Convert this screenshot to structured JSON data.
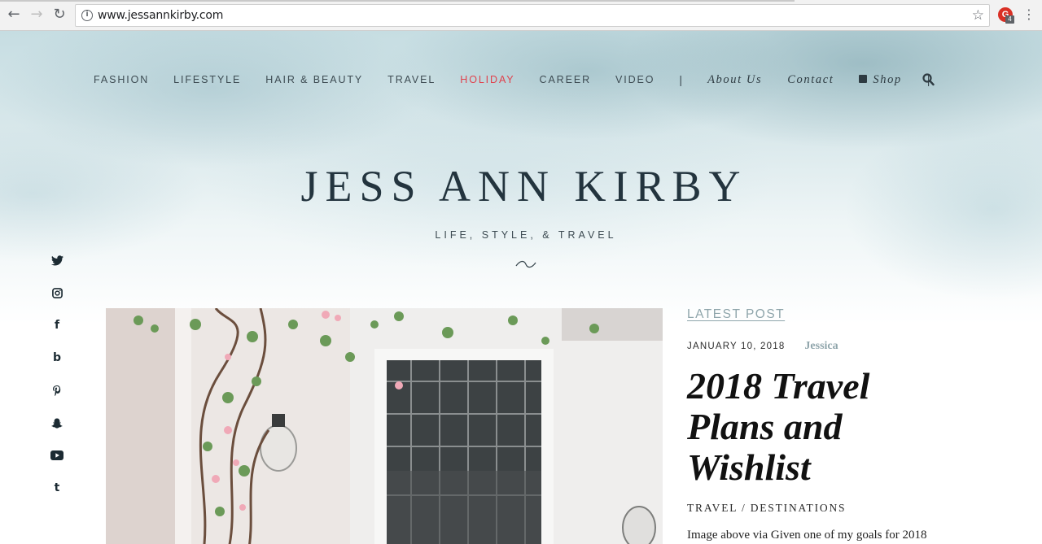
{
  "browser": {
    "url": "www.jessannkirby.com",
    "extension_badge": "4"
  },
  "nav": {
    "items": [
      {
        "label": "FASHION"
      },
      {
        "label": "LIFESTYLE"
      },
      {
        "label": "HAIR & BEAUTY"
      },
      {
        "label": "TRAVEL"
      },
      {
        "label": "HOLIDAY",
        "active": true
      },
      {
        "label": "CAREER"
      },
      {
        "label": "VIDEO"
      }
    ],
    "separator": "|",
    "about": "About Us",
    "contact": "Contact",
    "shop": "Shop",
    "active_color": "#e0414c"
  },
  "site": {
    "title": "JESS ANN KIRBY",
    "tagline": "LIFE, STYLE, & TRAVEL",
    "divider": "~"
  },
  "social_icons": [
    "twitter-icon",
    "instagram-icon",
    "facebook-icon",
    "bloglovin-icon",
    "pinterest-icon",
    "snapchat-icon",
    "youtube-icon",
    "tumblr-icon"
  ],
  "latest": {
    "label": "LATEST POST",
    "date": "JANUARY 10, 2018",
    "author": "Jessica",
    "title": "2018 Travel Plans and Wishlist",
    "categories": "TRAVEL / DESTINATIONS",
    "excerpt": "Image above via Given one of my goals for 2018"
  },
  "colors": {
    "accent_link": "#8fa5ab",
    "text_dark": "#23343e"
  }
}
